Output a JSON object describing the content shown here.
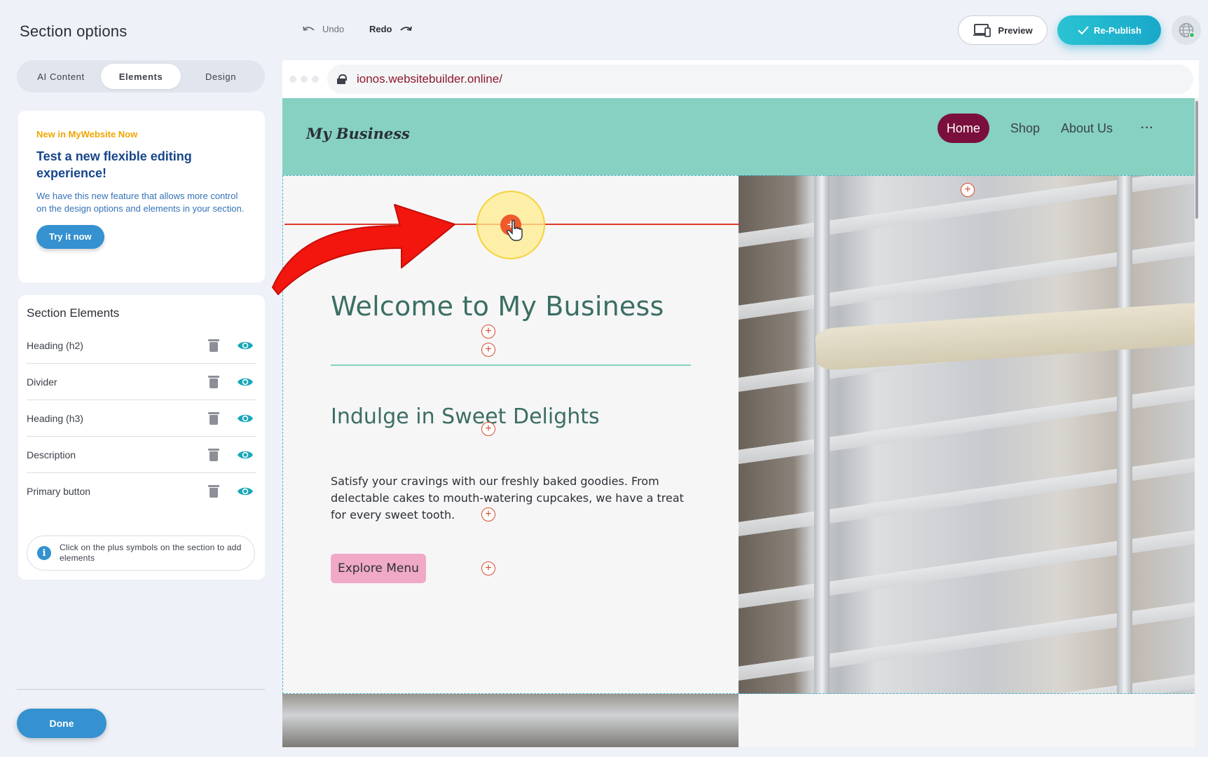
{
  "sidebar": {
    "title": "Section options",
    "tabs": [
      {
        "label": "AI Content",
        "active": false
      },
      {
        "label": "Elements",
        "active": true
      },
      {
        "label": "Design",
        "active": false
      }
    ],
    "promo": {
      "eyebrow": "New in MyWebsite Now",
      "title": "Test a new flexible editing experience!",
      "description": "We have this new feature that allows more control on the design options and elements in your section.",
      "button": "Try it now"
    },
    "elements": {
      "heading": "Section Elements",
      "items": [
        {
          "label": "Heading (h2)"
        },
        {
          "label": "Divider"
        },
        {
          "label": "Heading (h3)"
        },
        {
          "label": "Description"
        },
        {
          "label": "Primary button"
        }
      ],
      "hint": "Click on the plus symbols on the section to add elements"
    },
    "done_label": "Done"
  },
  "toolbar": {
    "undo_label": "Undo",
    "redo_label": "Redo",
    "preview_label": "Preview",
    "publish_label": "Re-Publish"
  },
  "browser": {
    "url": "ionos.websitebuilder.online/"
  },
  "site": {
    "brand": "My Business",
    "nav": [
      {
        "label": "Home",
        "active": true
      },
      {
        "label": "Shop",
        "active": false
      },
      {
        "label": "About Us",
        "active": false
      }
    ],
    "nav_more": "···",
    "heading_h2": "Welcome to My Business",
    "heading_h3": "Indulge in Sweet Delights",
    "description": "Satisfy your cravings with our freshly baked goodies. From delectable cakes to mouth-watering cupcakes, we have a treat for every sweet tooth.",
    "primary_button": "Explore Menu"
  },
  "colors": {
    "accent": "#3591cf",
    "publish": "#18a8c9",
    "header_bg": "#86d1c1",
    "nav_active": "#7a0f3d",
    "heading_text": "#3c6e63",
    "cta_bg": "#f0a9c6",
    "insert_marker": "#e0392a"
  },
  "icons": [
    "undo-icon",
    "redo-icon",
    "devices-icon",
    "check-icon",
    "globe-icon",
    "lock-icon",
    "trash-icon",
    "eye-icon",
    "info-icon",
    "plus-icon",
    "hand-cursor-icon",
    "red-arrow-annotation"
  ]
}
